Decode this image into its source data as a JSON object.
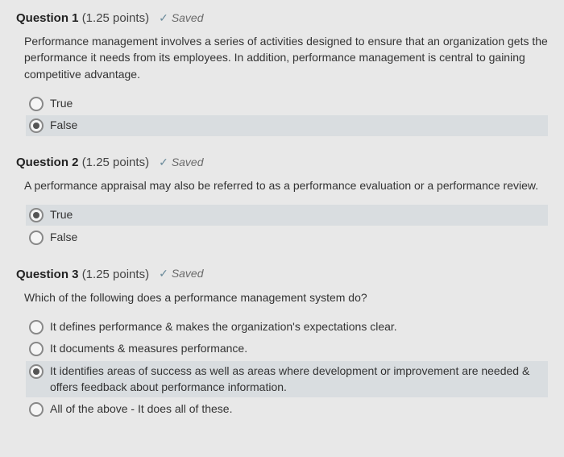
{
  "questions": [
    {
      "number": "Question 1",
      "points": "(1.25 points)",
      "saved": "Saved",
      "text": "Performance management involves a series of activities designed to ensure that an organization gets the performance it needs from its employees.  In addition, performance management is central to gaining competitive advantage.",
      "options": [
        {
          "label": "True",
          "selected": false
        },
        {
          "label": "False",
          "selected": true
        }
      ]
    },
    {
      "number": "Question 2",
      "points": "(1.25 points)",
      "saved": "Saved",
      "text": "A performance appraisal may also be referred to as a performance evaluation or a performance review.",
      "options": [
        {
          "label": "True",
          "selected": true
        },
        {
          "label": "False",
          "selected": false
        }
      ]
    },
    {
      "number": "Question 3",
      "points": "(1.25 points)",
      "saved": "Saved",
      "text": "Which of the following does a performance management system do?",
      "options": [
        {
          "label": "It defines performance & makes the organization's expectations clear.",
          "selected": false
        },
        {
          "label": "It documents & measures performance.",
          "selected": false
        },
        {
          "label": "It identifies areas of success as well as areas where development or improvement are needed & offers feedback about performance information.",
          "selected": true
        },
        {
          "label": "All of the above - It does all of these.",
          "selected": false
        }
      ]
    }
  ]
}
